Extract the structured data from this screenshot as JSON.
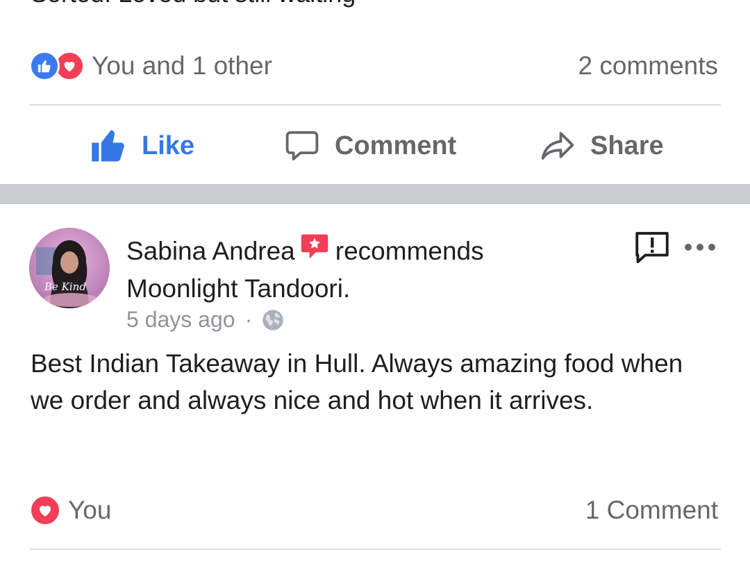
{
  "post1": {
    "cut_text": "Sorted. Loved but still waiting",
    "reactions_text": "You and 1 other",
    "comments_count": "2 comments",
    "actions": {
      "like": "Like",
      "comment": "Comment",
      "share": "Share"
    }
  },
  "post2": {
    "author": "Sabina Andrea",
    "verb": "recommends",
    "page": "Moonlight Tandoori.",
    "time": "5 days ago",
    "privacy_icon": "globe-icon",
    "body": "Best Indian Takeaway in Hull. Always amazing food when we order and always nice and hot when it arrives.",
    "reactions_text": "You",
    "comments_count": "1 Comment",
    "avatar_caption": "Be Kind"
  },
  "colors": {
    "facebook_blue": "#3578e5",
    "love_red": "#f23e57",
    "muted_text": "#65676b",
    "separator": "#c9ccd1"
  }
}
